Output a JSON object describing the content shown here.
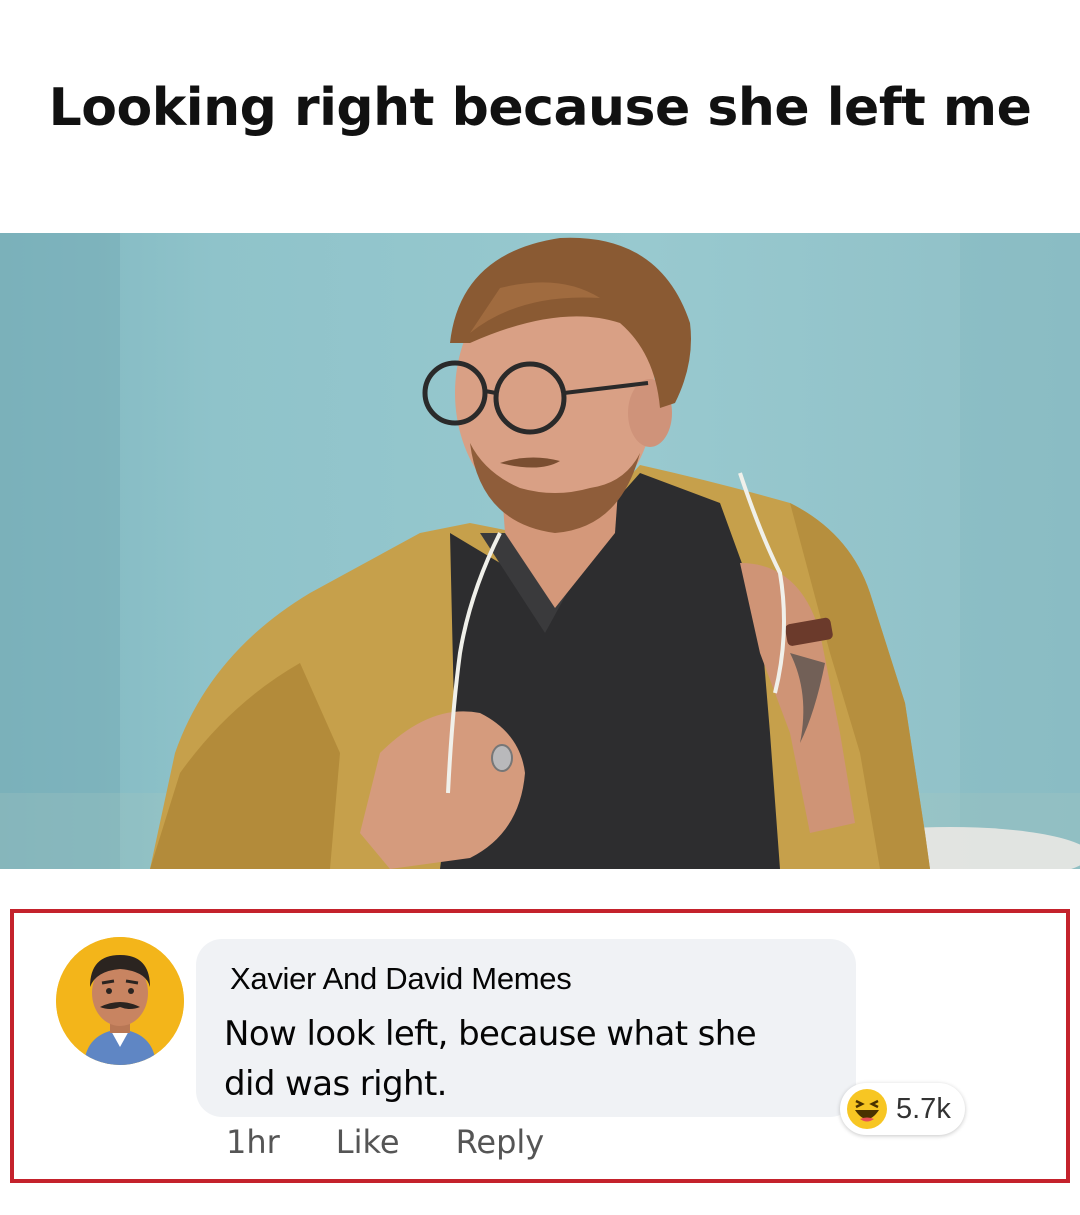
{
  "meme": {
    "caption": "Looking right because she left me"
  },
  "comment": {
    "author": "Xavier And David Memes",
    "text_line1": "Now look left, because what she",
    "text_line2": "did was right.",
    "time": "1hr",
    "like_label": "Like",
    "reply_label": "Reply",
    "reaction_icon": "haha-emoji-icon",
    "reaction_count": "5.7k",
    "highlight_color": "#c4222c"
  }
}
